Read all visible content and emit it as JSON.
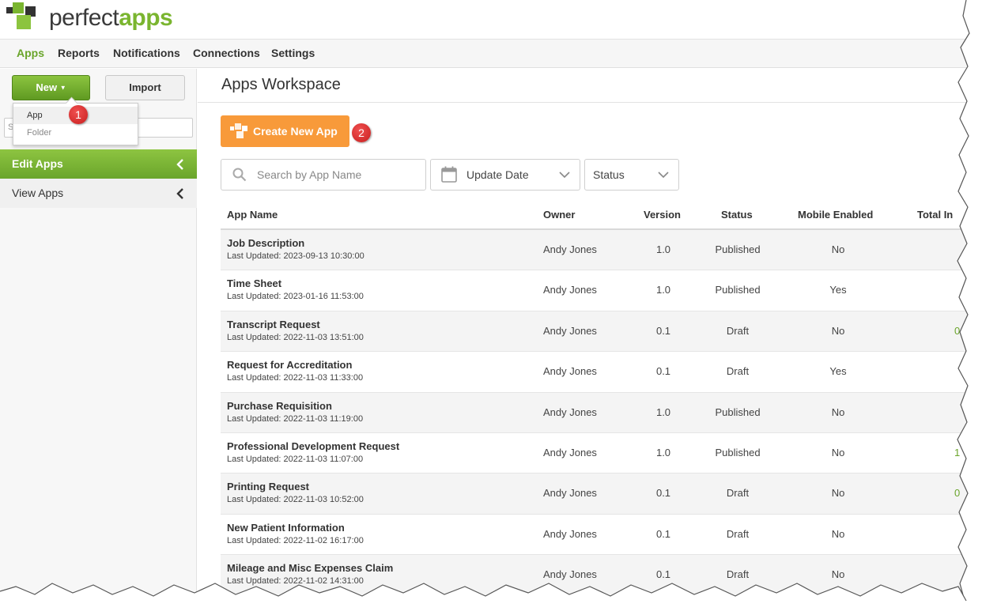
{
  "brand": {
    "word1": "perfect",
    "word2": "apps"
  },
  "nav": [
    "Apps",
    "Reports",
    "Notifications",
    "Connections",
    "Settings"
  ],
  "sidebar": {
    "new_label": "New",
    "import_label": "Import",
    "search_placeholder": "S",
    "dropdown": [
      "App",
      "Folder"
    ],
    "items": [
      "Edit Apps",
      "View Apps"
    ]
  },
  "callouts": [
    "1",
    "2"
  ],
  "main": {
    "title": "Apps Workspace",
    "create_label": "Create New App",
    "search_placeholder": "Search by App Name",
    "date_filter": "Update Date",
    "status_filter": "Status"
  },
  "table": {
    "headers": [
      "App Name",
      "Owner",
      "Version",
      "Status",
      "Mobile Enabled",
      "Total In"
    ],
    "rows": [
      {
        "name": "Job Description",
        "updated": "Last Updated: 2023-09-13 10:30:00",
        "owner": "Andy Jones",
        "version": "1.0",
        "status": "Published",
        "mobile": "No",
        "total": ""
      },
      {
        "name": "Time Sheet",
        "updated": "Last Updated: 2023-01-16 11:53:00",
        "owner": "Andy Jones",
        "version": "1.0",
        "status": "Published",
        "mobile": "Yes",
        "total": ""
      },
      {
        "name": "Transcript Request",
        "updated": "Last Updated: 2022-11-03 13:51:00",
        "owner": "Andy Jones",
        "version": "0.1",
        "status": "Draft",
        "mobile": "No",
        "total": "0"
      },
      {
        "name": "Request for Accreditation",
        "updated": "Last Updated: 2022-11-03 11:33:00",
        "owner": "Andy Jones",
        "version": "0.1",
        "status": "Draft",
        "mobile": "Yes",
        "total": ""
      },
      {
        "name": "Purchase Requisition",
        "updated": "Last Updated: 2022-11-03 11:19:00",
        "owner": "Andy Jones",
        "version": "1.0",
        "status": "Published",
        "mobile": "No",
        "total": ""
      },
      {
        "name": "Professional Development Request",
        "updated": "Last Updated: 2022-11-03 11:07:00",
        "owner": "Andy Jones",
        "version": "1.0",
        "status": "Published",
        "mobile": "No",
        "total": "1"
      },
      {
        "name": "Printing Request",
        "updated": "Last Updated: 2022-11-03 10:52:00",
        "owner": "Andy Jones",
        "version": "0.1",
        "status": "Draft",
        "mobile": "No",
        "total": "0"
      },
      {
        "name": "New Patient Information",
        "updated": "Last Updated: 2022-11-02 16:17:00",
        "owner": "Andy Jones",
        "version": "0.1",
        "status": "Draft",
        "mobile": "No",
        "total": ""
      },
      {
        "name": "Mileage and Misc Expenses Claim",
        "updated": "Last Updated: 2022-11-02 14:31:00",
        "owner": "Andy Jones",
        "version": "0.1",
        "status": "Draft",
        "mobile": "No",
        "total": ""
      }
    ]
  },
  "colors": {
    "green": "#7ab52f",
    "orange": "#f89a3a",
    "callout": "#d62828"
  }
}
